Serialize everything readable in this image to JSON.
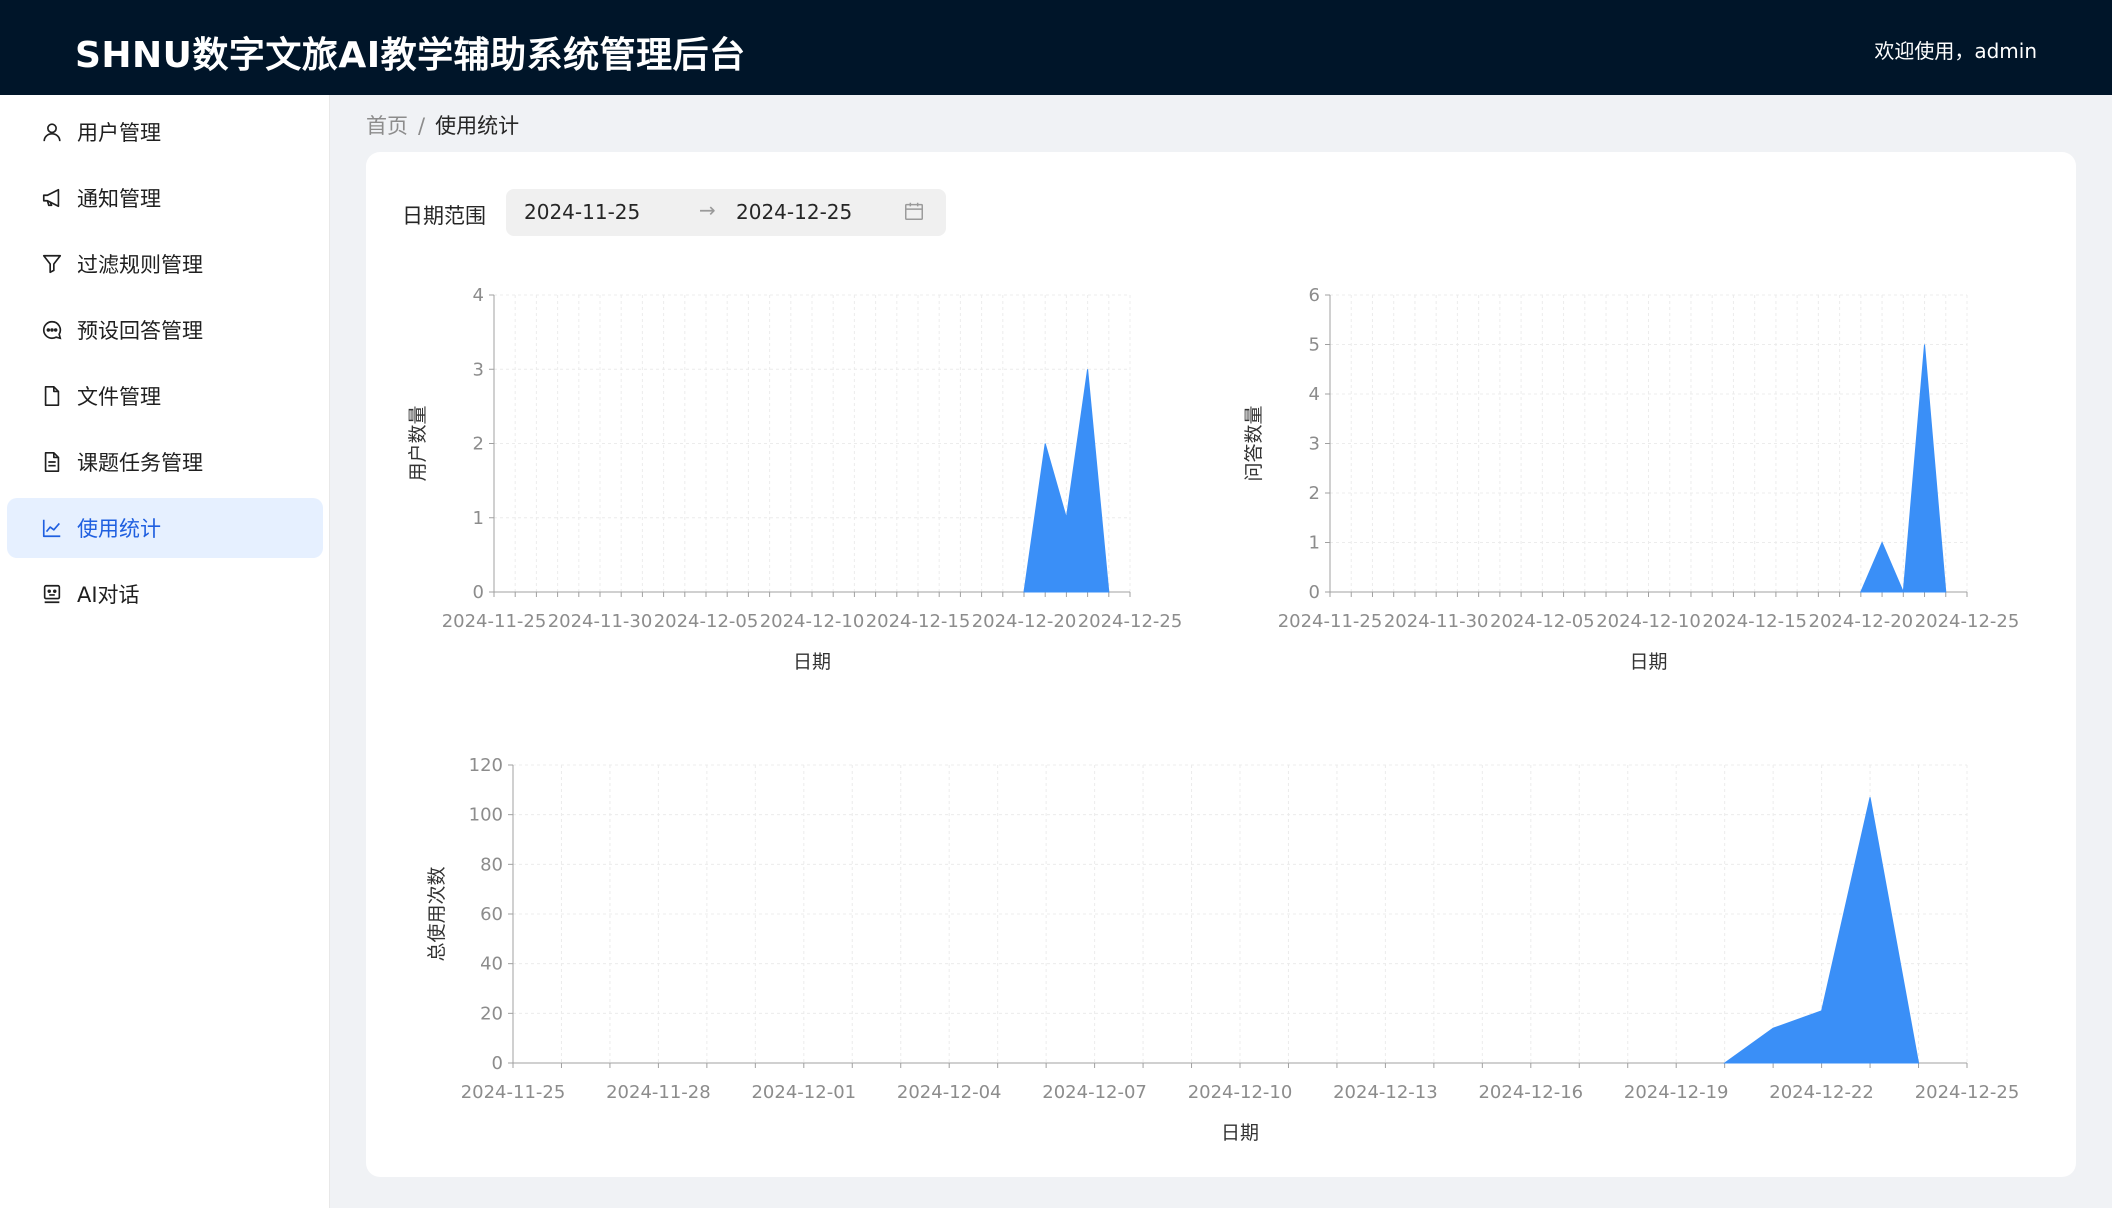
{
  "header": {
    "title": "SHNU数字文旅AI教学辅助系统管理后台",
    "welcome": "欢迎使用，admin"
  },
  "sidebar": {
    "items": [
      {
        "label": "用户管理",
        "icon": "user-icon",
        "active": false
      },
      {
        "label": "通知管理",
        "icon": "megaphone-icon",
        "active": false
      },
      {
        "label": "过滤规则管理",
        "icon": "filter-icon",
        "active": false
      },
      {
        "label": "预设回答管理",
        "icon": "message-icon",
        "active": false
      },
      {
        "label": "文件管理",
        "icon": "file-icon",
        "active": false
      },
      {
        "label": "课题任务管理",
        "icon": "file-text-icon",
        "active": false
      },
      {
        "label": "使用统计",
        "icon": "line-chart-icon",
        "active": true
      },
      {
        "label": "AI对话",
        "icon": "robot-icon",
        "active": false
      }
    ]
  },
  "breadcrumb": {
    "home": "首页",
    "separator": "/",
    "current": "使用统计"
  },
  "filter": {
    "label": "日期范围",
    "start": "2024-11-25",
    "end": "2024-12-25",
    "arrow": "→"
  },
  "colors": {
    "accent": "#1f5fe0",
    "area": "#3a8ff7",
    "header_bg": "#001529"
  },
  "chart_data": [
    {
      "type": "area",
      "xlabel": "日期",
      "ylabel": "用户数量",
      "ylim": [
        0,
        4
      ],
      "yticks": [
        0,
        1,
        2,
        3,
        4
      ],
      "x_range": [
        "2024-11-25",
        "2024-12-25"
      ],
      "xticks": [
        "2024-11-25",
        "2024-11-30",
        "2024-12-05",
        "2024-12-10",
        "2024-12-15",
        "2024-12-20",
        "2024-12-25"
      ],
      "grid": true,
      "points": [
        {
          "x": "2024-12-20",
          "y": 0
        },
        {
          "x": "2024-12-21",
          "y": 2
        },
        {
          "x": "2024-12-22",
          "y": 1
        },
        {
          "x": "2024-12-23",
          "y": 3
        },
        {
          "x": "2024-12-24",
          "y": 0
        }
      ]
    },
    {
      "type": "area",
      "xlabel": "日期",
      "ylabel": "问答数量",
      "ylim": [
        0,
        6
      ],
      "yticks": [
        0,
        1,
        2,
        3,
        4,
        5,
        6
      ],
      "x_range": [
        "2024-11-25",
        "2024-12-25"
      ],
      "xticks": [
        "2024-11-25",
        "2024-11-30",
        "2024-12-05",
        "2024-12-10",
        "2024-12-15",
        "2024-12-20",
        "2024-12-25"
      ],
      "grid": true,
      "points": [
        {
          "x": "2024-12-20",
          "y": 0
        },
        {
          "x": "2024-12-21",
          "y": 1
        },
        {
          "x": "2024-12-22",
          "y": 0
        },
        {
          "x": "2024-12-23",
          "y": 5
        },
        {
          "x": "2024-12-24",
          "y": 0
        }
      ]
    },
    {
      "type": "area",
      "xlabel": "日期",
      "ylabel": "总使用次数",
      "ylim": [
        0,
        120
      ],
      "yticks": [
        0,
        20,
        40,
        60,
        80,
        100,
        120
      ],
      "x_range": [
        "2024-11-25",
        "2024-12-25"
      ],
      "xticks": [
        "2024-11-25",
        "2024-11-28",
        "2024-12-01",
        "2024-12-04",
        "2024-12-07",
        "2024-12-10",
        "2024-12-13",
        "2024-12-16",
        "2024-12-19",
        "2024-12-22",
        "2024-12-25"
      ],
      "grid": true,
      "points": [
        {
          "x": "2024-12-20",
          "y": 0
        },
        {
          "x": "2024-12-21",
          "y": 14
        },
        {
          "x": "2024-12-22",
          "y": 21
        },
        {
          "x": "2024-12-23",
          "y": 107
        },
        {
          "x": "2024-12-24",
          "y": 0
        }
      ]
    }
  ]
}
